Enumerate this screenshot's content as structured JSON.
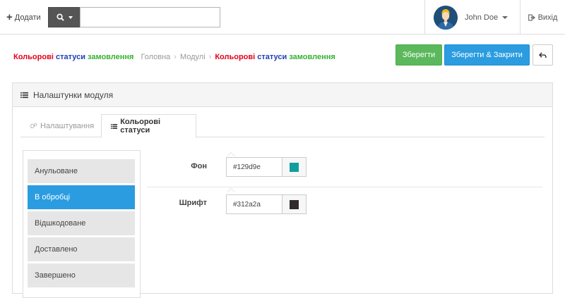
{
  "topbar": {
    "add_label": "Додати",
    "search_placeholder": "",
    "user_name": "John Doe",
    "logout_label": "Вихід"
  },
  "breadcrumb": {
    "title_part1": "Кольорові",
    "title_part2": "статуси",
    "title_part3": "замовлення",
    "home": "Головна",
    "modules": "Модулі",
    "current_part1": "Кольорові",
    "current_part2": "статуси",
    "current_part3": "замовлення"
  },
  "actions": {
    "save": "Зберегти",
    "save_close": "Зберегти & Закрити"
  },
  "panel": {
    "title": "Налаштунки модуля",
    "tabs": [
      {
        "label": "Налаштування"
      },
      {
        "label": "Кольорові статуси"
      }
    ]
  },
  "statuses": [
    {
      "label": "Анульоване"
    },
    {
      "label": "В обробці"
    },
    {
      "label": "Відшкодоване"
    },
    {
      "label": "Доставлено"
    },
    {
      "label": "Завершено"
    }
  ],
  "fields": {
    "background": {
      "label": "Фон",
      "value": "#129d9e",
      "color": "#129d9e"
    },
    "font": {
      "label": "Шрифт",
      "value": "#312a2a",
      "color": "#312a2a"
    }
  },
  "colors": {
    "accent": "#2b9ce0",
    "save": "#5cb85c"
  }
}
